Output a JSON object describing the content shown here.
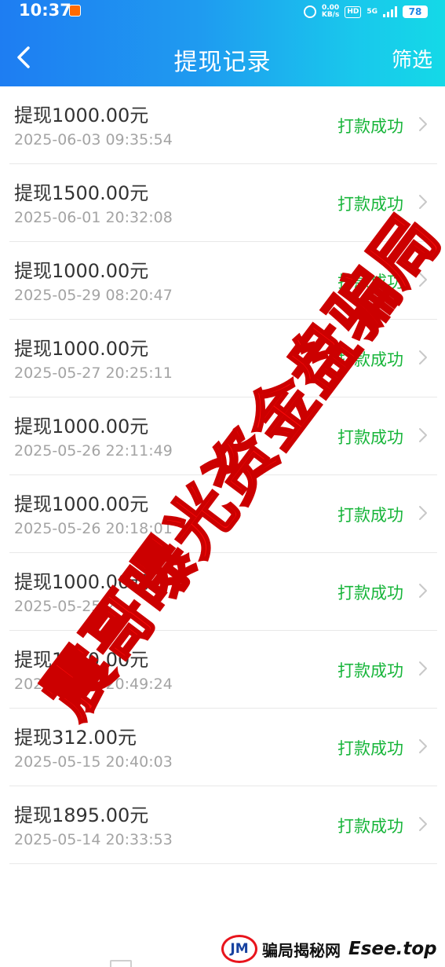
{
  "status_bar": {
    "time": "10:37",
    "speed_value": "0.00",
    "speed_unit": "KB/s",
    "hd_label": "HD",
    "network_label": "5G",
    "battery_level": "78"
  },
  "header": {
    "title": "提现记录",
    "filter_label": "筛选"
  },
  "records": [
    {
      "amount": "提现1000.00元",
      "time": "2025-06-03 09:35:54",
      "status": "打款成功"
    },
    {
      "amount": "提现1500.00元",
      "time": "2025-06-01 20:32:08",
      "status": "打款成功"
    },
    {
      "amount": "提现1000.00元",
      "time": "2025-05-29 08:20:47",
      "status": "打款成功"
    },
    {
      "amount": "提现1000.00元",
      "time": "2025-05-27 20:25:11",
      "status": "打款成功"
    },
    {
      "amount": "提现1000.00元",
      "time": "2025-05-26 22:11:49",
      "status": "打款成功"
    },
    {
      "amount": "提现1000.00元",
      "time": "2025-05-26 20:18:01",
      "status": "打款成功"
    },
    {
      "amount": "提现1000.00元",
      "time": "2025-05-25 2",
      "status": "打款成功"
    },
    {
      "amount": "提现1000.00元",
      "time": "2025-05-24 20:49:24",
      "status": "打款成功"
    },
    {
      "amount": "提现312.00元",
      "time": "2025-05-15 20:40:03",
      "status": "打款成功"
    },
    {
      "amount": "提现1895.00元",
      "time": "2025-05-14 20:33:53",
      "status": "打款成功"
    }
  ],
  "watermark": {
    "text": "震哥曝光资金盘骗局",
    "color": "#ff0a0a"
  },
  "footer": {
    "logo_text": "JM",
    "brand": "骗局揭秘网",
    "site": "Esee.top"
  },
  "colors": {
    "header_gradient_start": "#1e7df2",
    "header_gradient_end": "#14d9e7",
    "status_success": "#17b53a"
  }
}
